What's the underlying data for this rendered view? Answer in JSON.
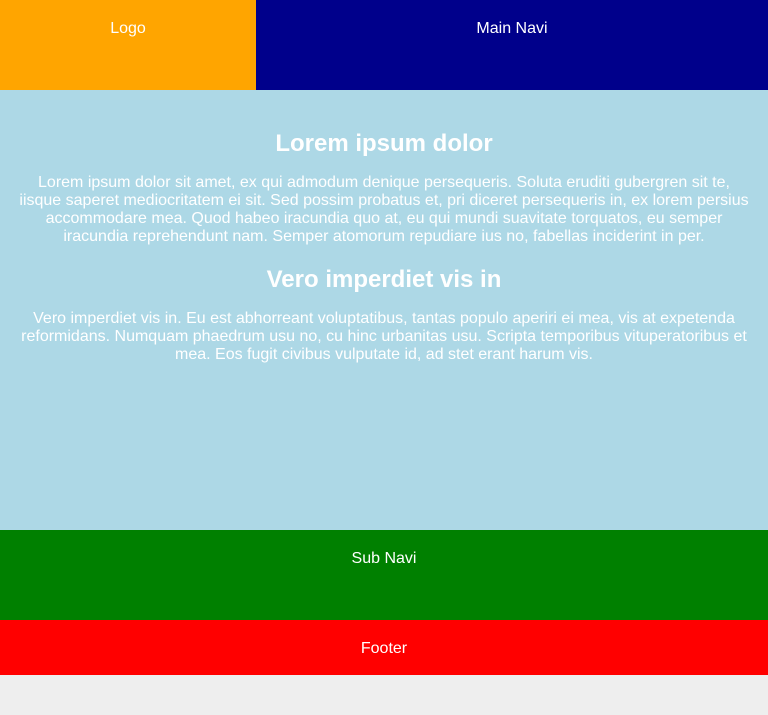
{
  "header": {
    "logo_label": "Logo",
    "main_navi_label": "Main Navi"
  },
  "content": {
    "heading1": "Lorem ipsum dolor",
    "paragraph1": "Lorem ipsum dolor sit amet, ex qui admodum denique persequeris. Soluta eruditi gubergren sit te, iisque saperet mediocritatem ei sit. Sed possim probatus et, pri diceret persequeris in, ex lorem persius accommodare mea. Quod habeo iracundia quo at, eu qui mundi suavitate torquatos, eu semper iracundia reprehendunt nam. Semper atomorum repudiare ius no, fabellas inciderint in per.",
    "heading2": "Vero imperdiet vis in",
    "paragraph2": "Vero imperdiet vis in. Eu est abhorreant voluptatibus, tantas populo aperiri ei mea, vis at expetenda reformidans. Numquam phaedrum usu no, cu hinc urbanitas usu. Scripta temporibus vituperatoribus et mea. Eos fugit civibus vulputate id, ad stet erant harum vis."
  },
  "sub_navi": {
    "label": "Sub Navi"
  },
  "footer": {
    "label": "Footer"
  },
  "colors": {
    "logo": "#ffa500",
    "main_navi": "#00008b",
    "content": "#add8e6",
    "sub_navi": "#008000",
    "footer": "#ff0000",
    "page_background": "#eeeeee"
  }
}
